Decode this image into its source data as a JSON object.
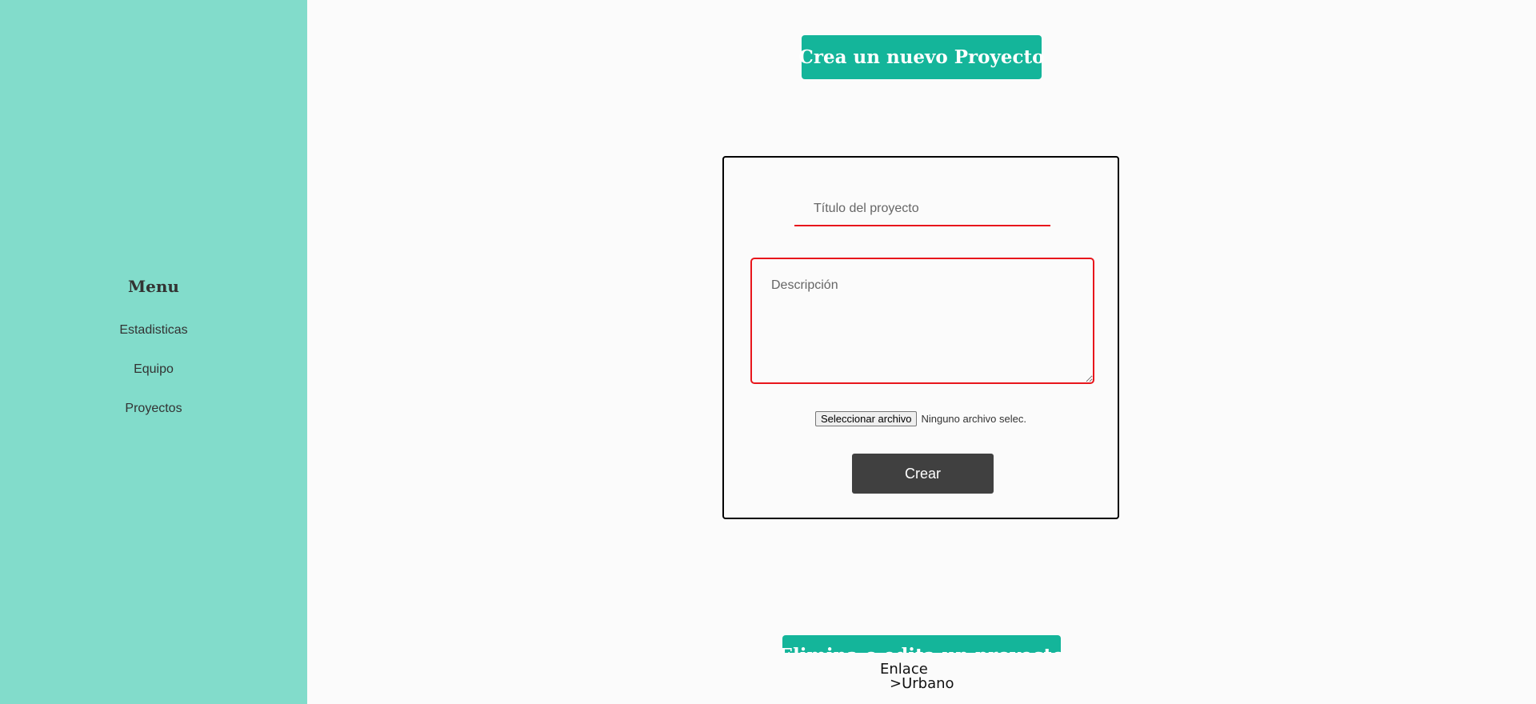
{
  "sidebar": {
    "menu_title": "Menu",
    "items": [
      {
        "label": "Estadisticas"
      },
      {
        "label": "Equipo"
      },
      {
        "label": "Proyectos"
      }
    ]
  },
  "header": {
    "button_label": "Crea un nuevo Proyecto"
  },
  "form": {
    "title_placeholder": "Título del proyecto",
    "title_value": "",
    "description_placeholder": "Descripción",
    "description_value": "",
    "file_button_label": "Seleccionar archivo",
    "file_status": "Ninguno archivo selec.",
    "submit_label": "Crear"
  },
  "next_section": {
    "button_label": "Elimina o edita un proyecto"
  },
  "footer": {
    "logo_line1": "Enlace",
    "logo_line2": ">Urbano"
  },
  "colors": {
    "sidebar_bg": "#82dccb",
    "accent": "#14b59a",
    "error_border": "#e8161c",
    "submit_bg": "#404040",
    "page_bg": "#fbfbfb"
  }
}
